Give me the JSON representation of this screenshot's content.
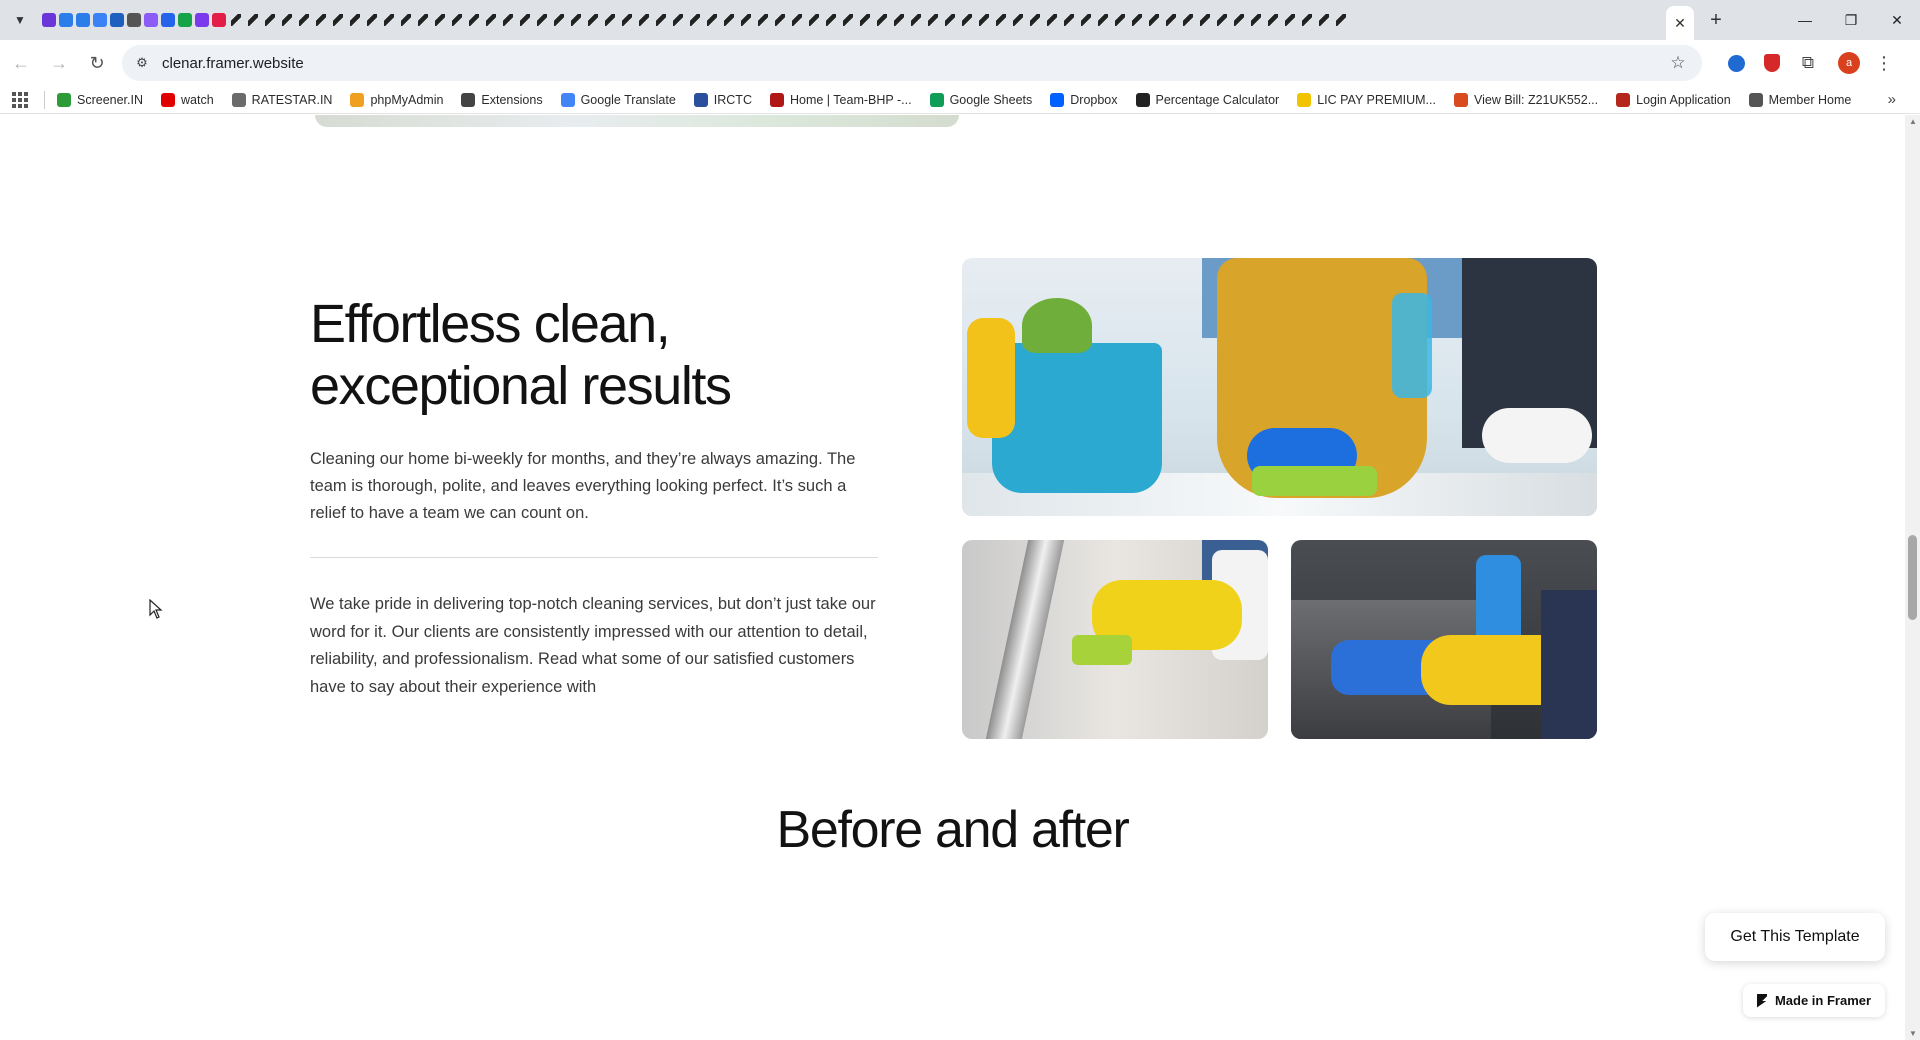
{
  "browser": {
    "url": "clenar.framer.website",
    "profile_initial": "a",
    "pinned_tab_colors": [
      "#6a35d9",
      "#2b7de9",
      "#2b7de9",
      "#3b82f6",
      "#1f5fbf",
      "#555555",
      "#8b5cf6",
      "#2563eb",
      "#16a34a",
      "#7c3aed",
      "#e11d48"
    ],
    "bookmarks": [
      {
        "label": "Screener.IN",
        "icon": "screener-icon",
        "color": "#2e9b3a"
      },
      {
        "label": "watch",
        "icon": "youtube-icon",
        "color": "#e00000"
      },
      {
        "label": "RATESTAR.IN",
        "icon": "ratestar-icon",
        "color": "#6b6b6b"
      },
      {
        "label": "phpMyAdmin",
        "icon": "phpmyadmin-icon",
        "color": "#f0a020"
      },
      {
        "label": "Extensions",
        "icon": "puzzle-icon",
        "color": "#444444"
      },
      {
        "label": "Google Translate",
        "icon": "translate-icon",
        "color": "#4285f4"
      },
      {
        "label": "IRCTC",
        "icon": "irctc-icon",
        "color": "#2a4f9c"
      },
      {
        "label": "Home | Team-BHP -...",
        "icon": "teambhp-icon",
        "color": "#b01818"
      },
      {
        "label": "Google Sheets",
        "icon": "sheets-icon",
        "color": "#0f9d58"
      },
      {
        "label": "Dropbox",
        "icon": "dropbox-icon",
        "color": "#0061fe"
      },
      {
        "label": "Percentage Calculator",
        "icon": "calculator-icon",
        "color": "#222222"
      },
      {
        "label": "LIC PAY PREMIUM...",
        "icon": "lic-icon",
        "color": "#f2c400"
      },
      {
        "label": "View Bill: Z21UK552...",
        "icon": "bill-icon",
        "color": "#d94b1f"
      },
      {
        "label": "Login Application",
        "icon": "login-icon",
        "color": "#b5271d"
      },
      {
        "label": "Member Home",
        "icon": "globe-icon",
        "color": "#555555"
      }
    ]
  },
  "content": {
    "hero_title_line1": "Effortless clean,",
    "hero_title_line2": "exceptional results",
    "hero_quote": "Cleaning our home bi-weekly for months, and they’re always amazing. The team is thorough, polite, and leaves everything looking perfect. It’s such a relief to have a team we can count on.",
    "hero_body": "We take pride in delivering top-notch cleaning services, but don’t just take our word for it. Our clients are consistently impressed with our attention to detail, reliability, and professionalism. Read what some of our satisfied customers have to say about their experience with",
    "section_title": "Before and after"
  },
  "floating": {
    "get_template": "Get This Template",
    "made_in_framer": "Made in Framer"
  }
}
